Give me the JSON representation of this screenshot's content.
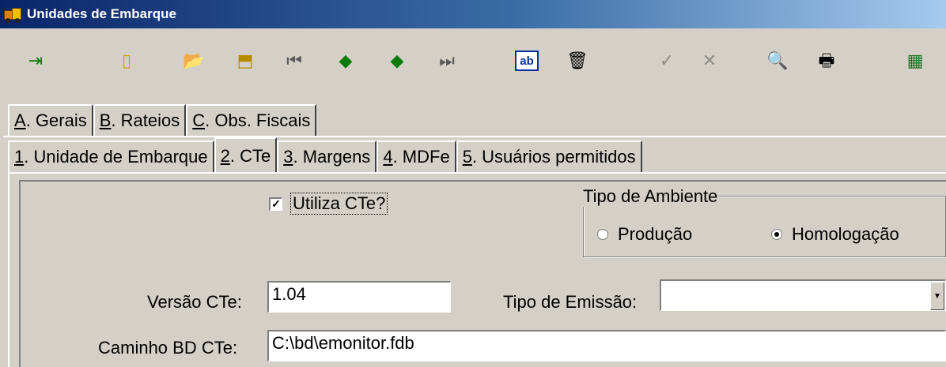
{
  "window": {
    "title": "Unidades de Embarque"
  },
  "toolbar": {
    "exit_icon": "⇥",
    "new_icon": "▯",
    "open_icon": "📂",
    "edit_icon": "⬒",
    "first_icon": "⏮",
    "prev_icon": "◆",
    "next_icon": "◆",
    "last_icon": "⏭",
    "rename_icon": "ab",
    "delete_icon": "🗑",
    "confirm_icon": "✓",
    "cancel_icon": "✕",
    "search_icon": "🔍",
    "print_icon": "🖶",
    "calculator_icon": "▦"
  },
  "tabs_top": [
    {
      "key": "A",
      "label": ". Gerais"
    },
    {
      "key": "B",
      "label": ". Rateios"
    },
    {
      "key": "C",
      "label": ". Obs. Fiscais"
    }
  ],
  "tabs_sub": [
    {
      "key": "1",
      "label": ". Unidade de Embarque"
    },
    {
      "key": "2",
      "label": ". CTe"
    },
    {
      "key": "3",
      "label": ". Margens"
    },
    {
      "key": "4",
      "label": ". MDFe"
    },
    {
      "key": "5",
      "label": ". Usuários permitidos"
    }
  ],
  "cte": {
    "uses_cte_label": "Utiliza CTe?",
    "uses_cte_checked": true,
    "environment": {
      "legend": "Tipo de Ambiente",
      "option_producao": "Produção",
      "option_homologacao": "Homologação",
      "selected": "Homologação"
    },
    "versao_label": "Versão CTe:",
    "versao_value": "1.04",
    "tipo_emissao_label": "Tipo de Emissão:",
    "tipo_emissao_value": "",
    "caminho_label": "Caminho BD CTe:",
    "caminho_value": "C:\\bd\\emonitor.fdb"
  }
}
